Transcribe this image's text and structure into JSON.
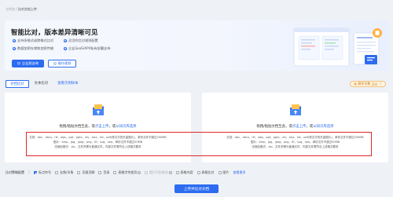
{
  "breadcrumb": {
    "parent": "工作台",
    "sep": " / ",
    "current": "比对文档上传"
  },
  "hero": {
    "title": "智能比对，版本差异清晰可见",
    "features": [
      "支持多格式或跨格式比对",
      "灵活的比对规则配置",
      "数据加密存储和加密传输",
      "企业SaaS/API/私有部署支持"
    ],
    "enterprise_btn": "企业版咨询",
    "guide_btn": "操作视频"
  },
  "tabs": {
    "doc": "文档比对",
    "text": "文本比对",
    "sample": "查看示例样本"
  },
  "remaining": {
    "label": "剩余次数",
    "count": "202"
  },
  "upload": {
    "drop_prefix": "拖拽/粘贴文档至此，或",
    "click_upload": "点击上传",
    "or": "，或",
    "from_kb": "从知识库选择",
    "fmt_line1": "文档：doc、docx、rtf、wps、ppt、pptx、xls、xlsx、txt、pdf(带文字的矢量图片)、单份文件不超过200MB",
    "fmt_line2": "图片：bmp、jpg、jpeg、png、tif、svg、raw、单份文件不超过20MB",
    "fmt_line3": "压缩包格式：zip、文件夹需为普通文件，内部文件需符合上述格式要求"
  },
  "options": {
    "label": "比对策略配置",
    "items": [
      {
        "label": "标点符号",
        "checked": true,
        "disabled": false
      },
      {
        "label": "全角/半角",
        "checked": false,
        "disabled": false
      },
      {
        "label": "页眉页脚",
        "checked": false,
        "disabled": false
      },
      {
        "label": "目录",
        "checked": false,
        "disabled": false
      },
      {
        "label": "表格字符差异",
        "checked": false,
        "disabled": false
      },
      {
        "label": "图片识别差异",
        "checked": false,
        "disabled": true
      },
      {
        "label": "表格内容",
        "checked": false,
        "disabled": false
      },
      {
        "label": "表格比对",
        "checked": false,
        "disabled": false
      },
      {
        "label": "图片",
        "checked": false,
        "disabled": false
      }
    ],
    "view_more": "查看更多"
  },
  "submit": "上传并比对文档",
  "colors": {
    "primary": "#2d6cf0",
    "annotation": "#e0262b",
    "warning": "#c77b00"
  }
}
